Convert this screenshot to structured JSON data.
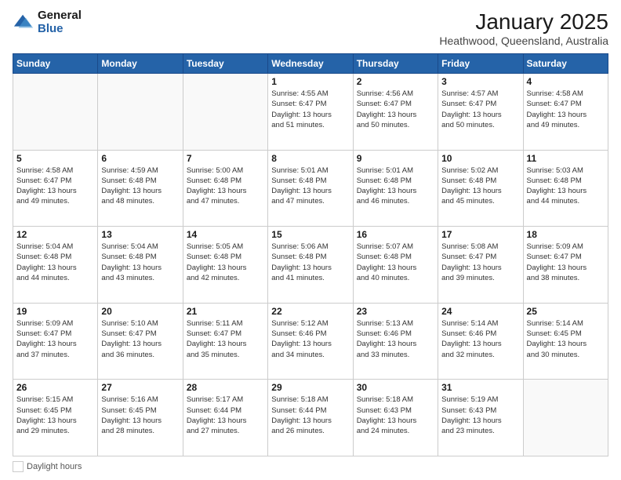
{
  "logo": {
    "general": "General",
    "blue": "Blue"
  },
  "title": "January 2025",
  "location": "Heathwood, Queensland, Australia",
  "days_of_week": [
    "Sunday",
    "Monday",
    "Tuesday",
    "Wednesday",
    "Thursday",
    "Friday",
    "Saturday"
  ],
  "weeks": [
    [
      {
        "day": "",
        "info": ""
      },
      {
        "day": "",
        "info": ""
      },
      {
        "day": "",
        "info": ""
      },
      {
        "day": "1",
        "info": "Sunrise: 4:55 AM\nSunset: 6:47 PM\nDaylight: 13 hours\nand 51 minutes."
      },
      {
        "day": "2",
        "info": "Sunrise: 4:56 AM\nSunset: 6:47 PM\nDaylight: 13 hours\nand 50 minutes."
      },
      {
        "day": "3",
        "info": "Sunrise: 4:57 AM\nSunset: 6:47 PM\nDaylight: 13 hours\nand 50 minutes."
      },
      {
        "day": "4",
        "info": "Sunrise: 4:58 AM\nSunset: 6:47 PM\nDaylight: 13 hours\nand 49 minutes."
      }
    ],
    [
      {
        "day": "5",
        "info": "Sunrise: 4:58 AM\nSunset: 6:47 PM\nDaylight: 13 hours\nand 49 minutes."
      },
      {
        "day": "6",
        "info": "Sunrise: 4:59 AM\nSunset: 6:48 PM\nDaylight: 13 hours\nand 48 minutes."
      },
      {
        "day": "7",
        "info": "Sunrise: 5:00 AM\nSunset: 6:48 PM\nDaylight: 13 hours\nand 47 minutes."
      },
      {
        "day": "8",
        "info": "Sunrise: 5:01 AM\nSunset: 6:48 PM\nDaylight: 13 hours\nand 47 minutes."
      },
      {
        "day": "9",
        "info": "Sunrise: 5:01 AM\nSunset: 6:48 PM\nDaylight: 13 hours\nand 46 minutes."
      },
      {
        "day": "10",
        "info": "Sunrise: 5:02 AM\nSunset: 6:48 PM\nDaylight: 13 hours\nand 45 minutes."
      },
      {
        "day": "11",
        "info": "Sunrise: 5:03 AM\nSunset: 6:48 PM\nDaylight: 13 hours\nand 44 minutes."
      }
    ],
    [
      {
        "day": "12",
        "info": "Sunrise: 5:04 AM\nSunset: 6:48 PM\nDaylight: 13 hours\nand 44 minutes."
      },
      {
        "day": "13",
        "info": "Sunrise: 5:04 AM\nSunset: 6:48 PM\nDaylight: 13 hours\nand 43 minutes."
      },
      {
        "day": "14",
        "info": "Sunrise: 5:05 AM\nSunset: 6:48 PM\nDaylight: 13 hours\nand 42 minutes."
      },
      {
        "day": "15",
        "info": "Sunrise: 5:06 AM\nSunset: 6:48 PM\nDaylight: 13 hours\nand 41 minutes."
      },
      {
        "day": "16",
        "info": "Sunrise: 5:07 AM\nSunset: 6:48 PM\nDaylight: 13 hours\nand 40 minutes."
      },
      {
        "day": "17",
        "info": "Sunrise: 5:08 AM\nSunset: 6:47 PM\nDaylight: 13 hours\nand 39 minutes."
      },
      {
        "day": "18",
        "info": "Sunrise: 5:09 AM\nSunset: 6:47 PM\nDaylight: 13 hours\nand 38 minutes."
      }
    ],
    [
      {
        "day": "19",
        "info": "Sunrise: 5:09 AM\nSunset: 6:47 PM\nDaylight: 13 hours\nand 37 minutes."
      },
      {
        "day": "20",
        "info": "Sunrise: 5:10 AM\nSunset: 6:47 PM\nDaylight: 13 hours\nand 36 minutes."
      },
      {
        "day": "21",
        "info": "Sunrise: 5:11 AM\nSunset: 6:47 PM\nDaylight: 13 hours\nand 35 minutes."
      },
      {
        "day": "22",
        "info": "Sunrise: 5:12 AM\nSunset: 6:46 PM\nDaylight: 13 hours\nand 34 minutes."
      },
      {
        "day": "23",
        "info": "Sunrise: 5:13 AM\nSunset: 6:46 PM\nDaylight: 13 hours\nand 33 minutes."
      },
      {
        "day": "24",
        "info": "Sunrise: 5:14 AM\nSunset: 6:46 PM\nDaylight: 13 hours\nand 32 minutes."
      },
      {
        "day": "25",
        "info": "Sunrise: 5:14 AM\nSunset: 6:45 PM\nDaylight: 13 hours\nand 30 minutes."
      }
    ],
    [
      {
        "day": "26",
        "info": "Sunrise: 5:15 AM\nSunset: 6:45 PM\nDaylight: 13 hours\nand 29 minutes."
      },
      {
        "day": "27",
        "info": "Sunrise: 5:16 AM\nSunset: 6:45 PM\nDaylight: 13 hours\nand 28 minutes."
      },
      {
        "day": "28",
        "info": "Sunrise: 5:17 AM\nSunset: 6:44 PM\nDaylight: 13 hours\nand 27 minutes."
      },
      {
        "day": "29",
        "info": "Sunrise: 5:18 AM\nSunset: 6:44 PM\nDaylight: 13 hours\nand 26 minutes."
      },
      {
        "day": "30",
        "info": "Sunrise: 5:18 AM\nSunset: 6:43 PM\nDaylight: 13 hours\nand 24 minutes."
      },
      {
        "day": "31",
        "info": "Sunrise: 5:19 AM\nSunset: 6:43 PM\nDaylight: 13 hours\nand 23 minutes."
      },
      {
        "day": "",
        "info": ""
      }
    ]
  ],
  "legend": {
    "daylight_label": "Daylight hours"
  }
}
